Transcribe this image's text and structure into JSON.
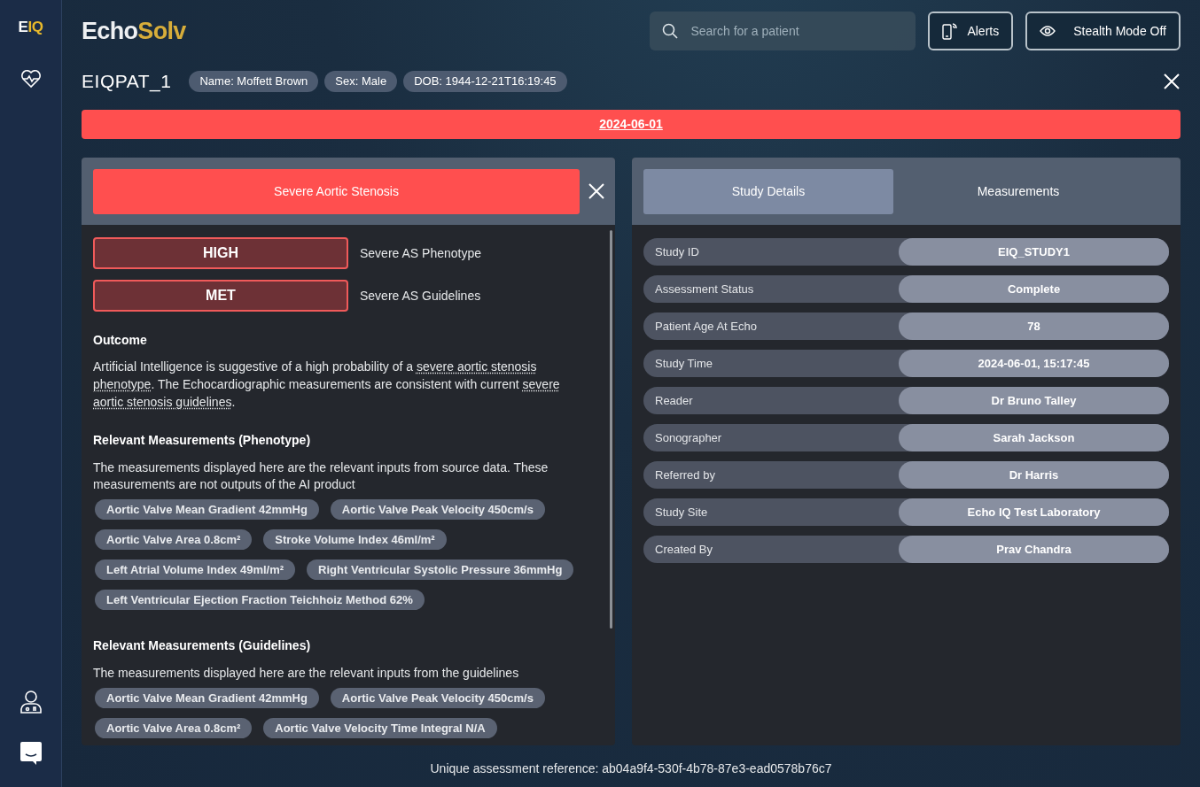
{
  "sidebar": {
    "logo": {
      "first": "E",
      "second": "IQ"
    },
    "items": [
      {
        "kind": "heart"
      },
      {
        "kind": "doctor"
      },
      {
        "kind": "chat"
      }
    ]
  },
  "header": {
    "logo": {
      "first": "Echo",
      "second": "Solv"
    },
    "search": {
      "placeholder": "Search for a patient"
    },
    "buttons": [
      {
        "kind": "alerts",
        "label": "Alerts"
      },
      {
        "kind": "stealth",
        "label": "Stealth Mode Off"
      }
    ]
  },
  "patient": {
    "id": "EIQPAT_1",
    "tags": [
      "Name: Moffett Brown",
      "Sex: Male",
      "DOB: 1944-12-21T16:19:45"
    ]
  },
  "date_bar": "2024-06-01",
  "assessment": {
    "title": "Severe Aortic Stenosis",
    "results": [
      {
        "badge": "HIGH",
        "label": "Severe AS Phenotype"
      },
      {
        "badge": "MET",
        "label": "Severe AS Guidelines"
      }
    ],
    "outcome_heading": "Outcome",
    "outcome": [
      {
        "kind": "plain",
        "text": "Artificial Intelligence is suggestive of a high probability of a "
      },
      {
        "kind": "term",
        "text": "severe aortic stenosis phenotype"
      },
      {
        "kind": "plain",
        "text": ". The Echocardiographic measurements are consistent with current "
      },
      {
        "kind": "term",
        "text": "severe aortic stenosis guidelines"
      },
      {
        "kind": "plain",
        "text": "."
      }
    ],
    "sections": [
      {
        "heading": "Relevant Measurements (Phenotype)",
        "note": "The measurements displayed here are the relevant inputs from source data. These measurements are not outputs of the AI product",
        "chips": [
          "Aortic Valve Mean Gradient 42mmHg",
          "Aortic Valve Peak Velocity 450cm/s",
          "Aortic Valve Area 0.8cm²",
          "Stroke Volume Index 46ml/m²",
          "Left Atrial Volume Index 49ml/m²",
          "Right Ventricular Systolic Pressure 36mmHg",
          "Left Ventricular Ejection Fraction Teichhoiz Method 62%"
        ]
      },
      {
        "heading": "Relevant Measurements (Guidelines)",
        "note": "The measurements displayed here are the relevant inputs from the guidelines",
        "chips": [
          "Aortic Valve Mean Gradient 42mmHg",
          "Aortic Valve Peak Velocity 450cm/s",
          "Aortic Valve Area 0.8cm²",
          "Aortic Valve Velocity Time Integral N/A"
        ]
      }
    ]
  },
  "details": {
    "tabs": [
      {
        "label": "Study Details",
        "selected": true
      },
      {
        "label": "Measurements",
        "selected": false
      }
    ],
    "rows": [
      {
        "label": "Study ID",
        "value": "EIQ_STUDY1"
      },
      {
        "label": "Assessment Status",
        "value": "Complete"
      },
      {
        "label": "Patient Age At Echo",
        "value": "78"
      },
      {
        "label": "Study Time",
        "value": "2024-06-01, 15:17:45"
      },
      {
        "label": "Reader",
        "value": "Dr Bruno Talley"
      },
      {
        "label": "Sonographer",
        "value": "Sarah Jackson"
      },
      {
        "label": "Referred by",
        "value": "Dr Harris"
      },
      {
        "label": "Study Site",
        "value": "Echo IQ Test Laboratory"
      },
      {
        "label": "Created By",
        "value": "Prav Chandra"
      }
    ]
  },
  "footer": "Unique assessment reference: ab04a9f4-530f-4b78-87e3-ead0578b76c7"
}
